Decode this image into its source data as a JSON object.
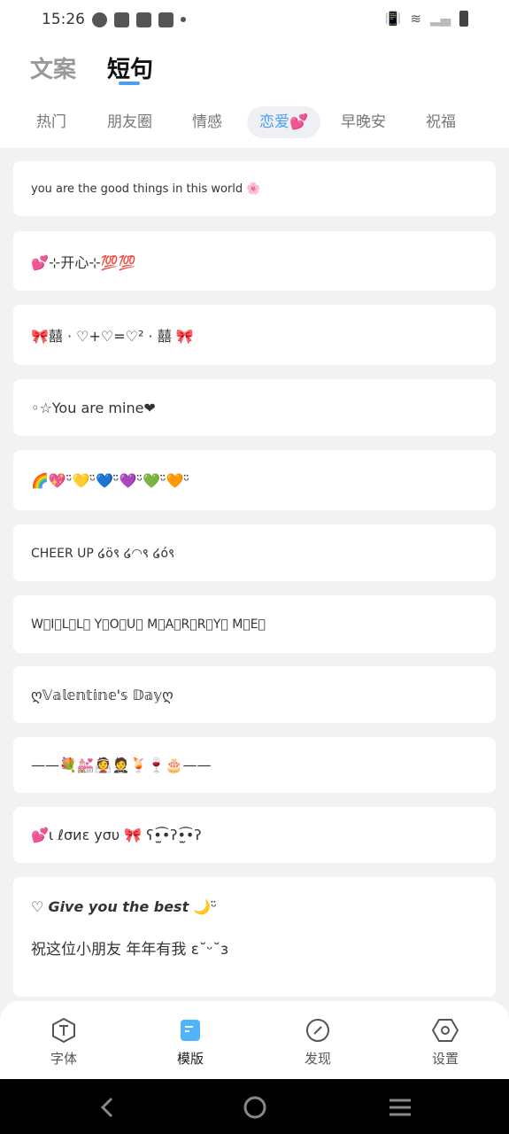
{
  "status_bar": {
    "time": "15:26"
  },
  "header": {
    "tabs": [
      {
        "label": "文案",
        "active": false
      },
      {
        "label": "短句",
        "active": true
      }
    ]
  },
  "categories": [
    {
      "label": "热门"
    },
    {
      "label": "朋友圈"
    },
    {
      "label": "情感"
    },
    {
      "label": "恋爱💕",
      "active": true
    },
    {
      "label": "早晚安"
    },
    {
      "label": "祝福"
    }
  ],
  "cards": [
    {
      "text": "you are the good things in this world 🌸"
    },
    {
      "text": "💕⊹开心⊹💯💯"
    },
    {
      "text": "🎀囍 · ♡+♡=♡² · 囍 🎀"
    },
    {
      "text": "◦☆You are mine❤"
    },
    {
      "text": "🌈💖ᵕ̈💛ᵕ̈💙ᵕ̈💜ᵕ̈💚ᵕ̈🧡ᵕ̈"
    },
    {
      "text": "CHEER UP ໒ö९ ໒◠९ ໒ó९"
    },
    {
      "text": "W⃞I⃞L⃞L⃞ Y⃞O⃞U⃞ M⃞A⃞R⃞R⃞Y⃞ M⃞E⃞"
    },
    {
      "text": "ღ𝕍𝕒𝕝𝕖𝕟𝕥𝕚𝕟𝕖'𝕤 𝔻𝕒𝕪ღ"
    },
    {
      "text": "——💐💒👰🤵🍹🍷🎂——"
    },
    {
      "text": "💕ɩ ℓσиε уσυ 🎀 ʕ•̫͡•ʔ•̫͡•ʔ"
    },
    {
      "line1_prefix": "♡ ",
      "line1_bold": "Give you the best",
      "line1_suffix": " 🌙ᵕ̈",
      "line2": "祝这位小朋友 年年有我 ε˘ᵕ˘з"
    }
  ],
  "bottom_nav": [
    {
      "label": "字体",
      "icon": "font-icon"
    },
    {
      "label": "模版",
      "icon": "template-icon",
      "active": true
    },
    {
      "label": "发现",
      "icon": "discover-icon"
    },
    {
      "label": "设置",
      "icon": "settings-icon"
    }
  ],
  "colors": {
    "accent": "#4a9ff5",
    "background": "#f2f2f2"
  }
}
